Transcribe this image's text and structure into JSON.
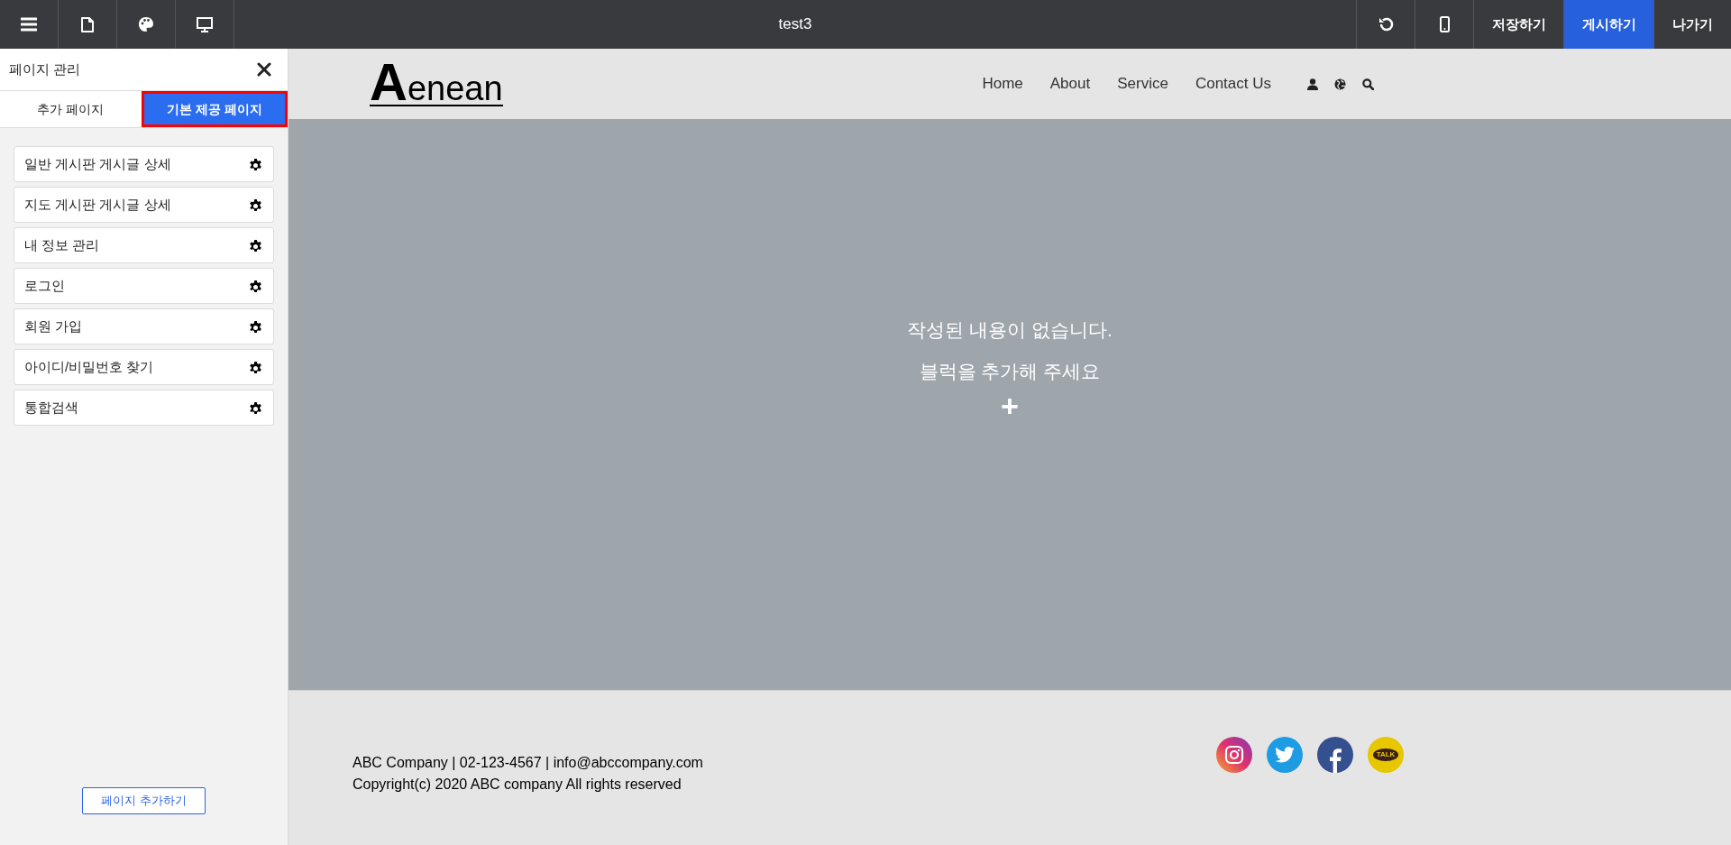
{
  "toolbar": {
    "left_tools": [
      {
        "kind": "menu"
      },
      {
        "kind": "page"
      },
      {
        "kind": "palette"
      },
      {
        "kind": "desktop"
      }
    ],
    "title": "test3",
    "right_tools": [
      {
        "kind": "undo"
      },
      {
        "kind": "mobile"
      }
    ],
    "buttons": [
      {
        "label": "저장하기",
        "primary": false
      },
      {
        "label": "게시하기",
        "primary": true
      },
      {
        "label": "나가기",
        "primary": false
      }
    ]
  },
  "sidebar": {
    "title": "페이지 관리",
    "tabs": [
      {
        "label": "추가 페이지",
        "selected": false
      },
      {
        "label": "기본 제공 페이지",
        "selected": true
      }
    ],
    "pages": [
      {
        "label": "일반 게시판 게시글 상세"
      },
      {
        "label": "지도 게시판 게시글 상세"
      },
      {
        "label": "내 정보 관리"
      },
      {
        "label": "로그인"
      },
      {
        "label": "회원 가입"
      },
      {
        "label": "아이디/비밀번호 찾기"
      },
      {
        "label": "통합검색"
      }
    ],
    "add_button": "페이지 추가하기"
  },
  "site": {
    "logo_initial": "A",
    "logo_rest": "enean",
    "nav": [
      "Home",
      "About",
      "Service",
      "Contact Us"
    ],
    "nav_icons": [
      {
        "kind": "user"
      },
      {
        "kind": "globe"
      },
      {
        "kind": "search"
      }
    ],
    "empty_message": [
      "작성된 내용이 없습니다.",
      "블럭을 추가해 주세요"
    ],
    "add_symbol": "+",
    "footer": {
      "lines": [
        "ABC Company | 02-123-4567 | info@abccompany.com",
        "Copyright(c) 2020 ABC company All rights reserved"
      ],
      "social": [
        {
          "kind": "instagram"
        },
        {
          "kind": "twitter"
        },
        {
          "kind": "facebook"
        },
        {
          "kind": "kakao",
          "label": "TALK"
        }
      ]
    }
  }
}
